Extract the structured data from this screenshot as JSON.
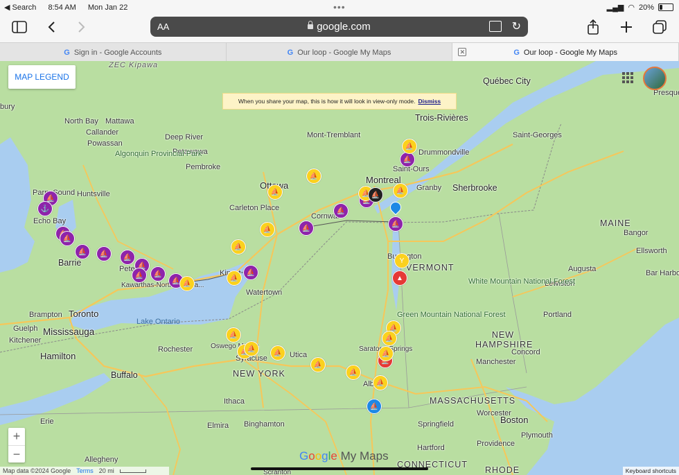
{
  "status_bar": {
    "back_app": "◀ Search",
    "time": "8:54 AM",
    "date": "Mon Jan 22",
    "battery": "20%",
    "battery_level": 0.2
  },
  "toolbar": {
    "text_size": "AA",
    "url": "google.com"
  },
  "tabs": [
    {
      "label": "Sign in - Google Accounts"
    },
    {
      "label": "Our loop - Google My Maps"
    },
    {
      "label": "Our loop - Google My Maps"
    }
  ],
  "map": {
    "legend_button": "MAP LEGEND",
    "banner_text": "When you share your map, this is how it will look in view-only mode.",
    "banner_dismiss": "Dismiss",
    "watermark": {
      "g1": "G",
      "g2": "o",
      "g3": "o",
      "g4": "g",
      "g5": "l",
      "g6": "e",
      "rest": " My Maps"
    },
    "footer": {
      "data": "Map data ©2024 Google",
      "terms": "Terms",
      "scale": "20 mi"
    },
    "shortcuts": "Keyboard shortcuts",
    "labels": {
      "quebec_city": "Québec City",
      "presque": "Presque",
      "bury": "bury",
      "zec": "ZEC Kipawa",
      "north_bay": "North Bay",
      "mattawa": "Mattawa",
      "callander": "Callander",
      "powassan": "Powassan",
      "deep_river": "Deep River",
      "petawawa": "Petawawa",
      "algonquin": "Algonquin Provincial Park",
      "pembroke": "Pembroke",
      "mont_tremblant": "Mont-Tremblant",
      "trois_rivieres": "Trois-Rivières",
      "drummondville": "Drummondville",
      "saint_georges": "Saint-Georges",
      "saint_ours": "Saint-Ours",
      "montreal": "Montreal",
      "granby": "Granby",
      "sherbrooke": "Sherbrooke",
      "ottawa": "Ottawa",
      "carleton_place": "Carleton Place",
      "cornwall": "Cornwall",
      "huntsville": "Huntsville",
      "parry_sound": "Parry Sound",
      "echo_bay": "Echo Bay",
      "barrie": "Barrie",
      "peterborough": "Peter",
      "kawarthas": "Kawarthas-Northumberla...",
      "kingston": "Kingst",
      "watertown": "Watertown",
      "maine": "MAINE",
      "bangor": "Bangor",
      "ellsworth": "Ellsworth",
      "augusta": "Augusta",
      "bar_harbor": "Bar Harbor",
      "lewiston": "Lewiston",
      "portland": "Portland",
      "white_mountain": "White Mountain National Forest",
      "burlington": "Burlington",
      "vermont": "VERMONT",
      "green_mountain": "Green Mountain National Forest",
      "new_hampshire": "NEW HAMPSHIRE",
      "concord": "Concord",
      "manchester": "Manchester",
      "brampton": "Brampton",
      "toronto": "Toronto",
      "guelph": "Guelph",
      "mississauga": "Mississauga",
      "kitchener": "Kitchener",
      "hamilton": "Hamilton",
      "lake_ontario": "Lake Ontario",
      "rochester": "Rochester",
      "oswego_marina": "Oswego Marina",
      "syracuse": "Syracuse",
      "utica": "Utica",
      "saratoga": "Saratoga Springs",
      "buffalo": "Buffalo",
      "new_york": "NEW YORK",
      "albany": "Albany",
      "ithaca": "Ithaca",
      "binghamton": "Binghamton",
      "elmira": "Elmira",
      "erie": "Erie",
      "allegheny": "Allegheny",
      "scranton": "Scranton",
      "massachusetts": "MASSACHUSETTS",
      "worcester": "Worcester",
      "boston": "Boston",
      "springfield": "Springfield",
      "plymouth": "Plymouth",
      "hartford": "Hartford",
      "providence": "Providence",
      "connecticut": "CONNECTICUT",
      "rhode": "RHODE"
    }
  },
  "colors": {
    "accent": "#1a73e8",
    "pin_purple": "#8e24aa",
    "pin_yellow": "#fbd11e",
    "pin_red": "#e53935",
    "pin_blue": "#1e88e5",
    "water": "#a9cdf0"
  },
  "icons": [
    "sidebar-icon",
    "back-chevron-icon",
    "forward-chevron-icon",
    "lock-icon",
    "reader-icon",
    "reload-icon",
    "share-icon",
    "new-tab-icon",
    "tabs-icon",
    "close-tab-icon",
    "apps-grid-icon",
    "sailboat-icon",
    "anchor-icon",
    "mountain-icon",
    "trophy-icon",
    "location-pin-icon"
  ]
}
